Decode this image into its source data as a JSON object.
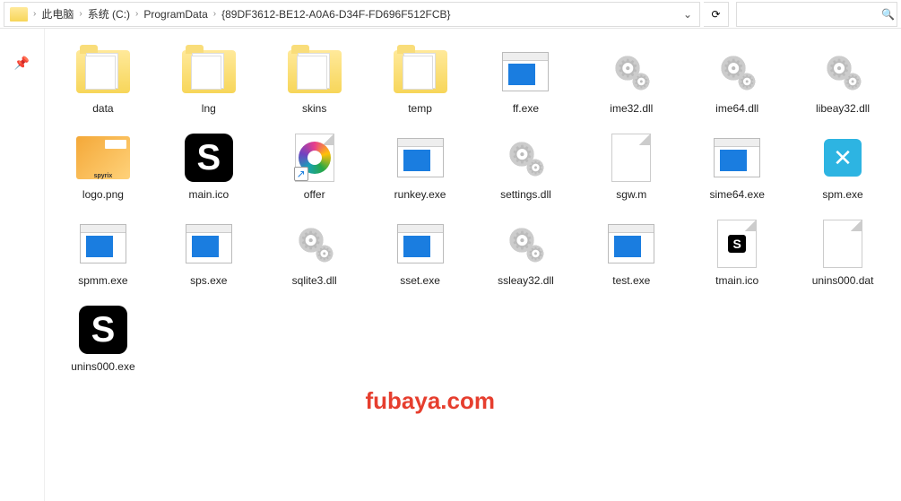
{
  "breadcrumb": {
    "items": [
      "此电脑",
      "系统 (C:)",
      "ProgramData",
      "{89DF3612-BE12-A0A6-D34F-FD696F512FCB}"
    ]
  },
  "search": {
    "placeholder": ""
  },
  "watermark": "fubaya.com",
  "files": [
    {
      "name": "data",
      "icon": "folder-docs"
    },
    {
      "name": "lng",
      "icon": "folder-docs"
    },
    {
      "name": "skins",
      "icon": "folder-docs"
    },
    {
      "name": "temp",
      "icon": "folder-docs"
    },
    {
      "name": "ff.exe",
      "icon": "app"
    },
    {
      "name": "ime32.dll",
      "icon": "gear"
    },
    {
      "name": "ime64.dll",
      "icon": "gear"
    },
    {
      "name": "libeay32.dll",
      "icon": "gear"
    },
    {
      "name": "logo.png",
      "icon": "logo"
    },
    {
      "name": "main.ico",
      "icon": "s-black"
    },
    {
      "name": "offer",
      "icon": "swirl-shortcut"
    },
    {
      "name": "runkey.exe",
      "icon": "app"
    },
    {
      "name": "settings.dll",
      "icon": "gear"
    },
    {
      "name": "sgw.m",
      "icon": "sheet"
    },
    {
      "name": "sime64.exe",
      "icon": "app"
    },
    {
      "name": "spm.exe",
      "icon": "tool"
    },
    {
      "name": "spmm.exe",
      "icon": "app"
    },
    {
      "name": "sps.exe",
      "icon": "app"
    },
    {
      "name": "sqlite3.dll",
      "icon": "gear"
    },
    {
      "name": "sset.exe",
      "icon": "app"
    },
    {
      "name": "ssleay32.dll",
      "icon": "gear"
    },
    {
      "name": "test.exe",
      "icon": "app"
    },
    {
      "name": "tmain.ico",
      "icon": "s-small"
    },
    {
      "name": "unins000.dat",
      "icon": "sheet"
    },
    {
      "name": "unins000.exe",
      "icon": "s-black"
    }
  ]
}
